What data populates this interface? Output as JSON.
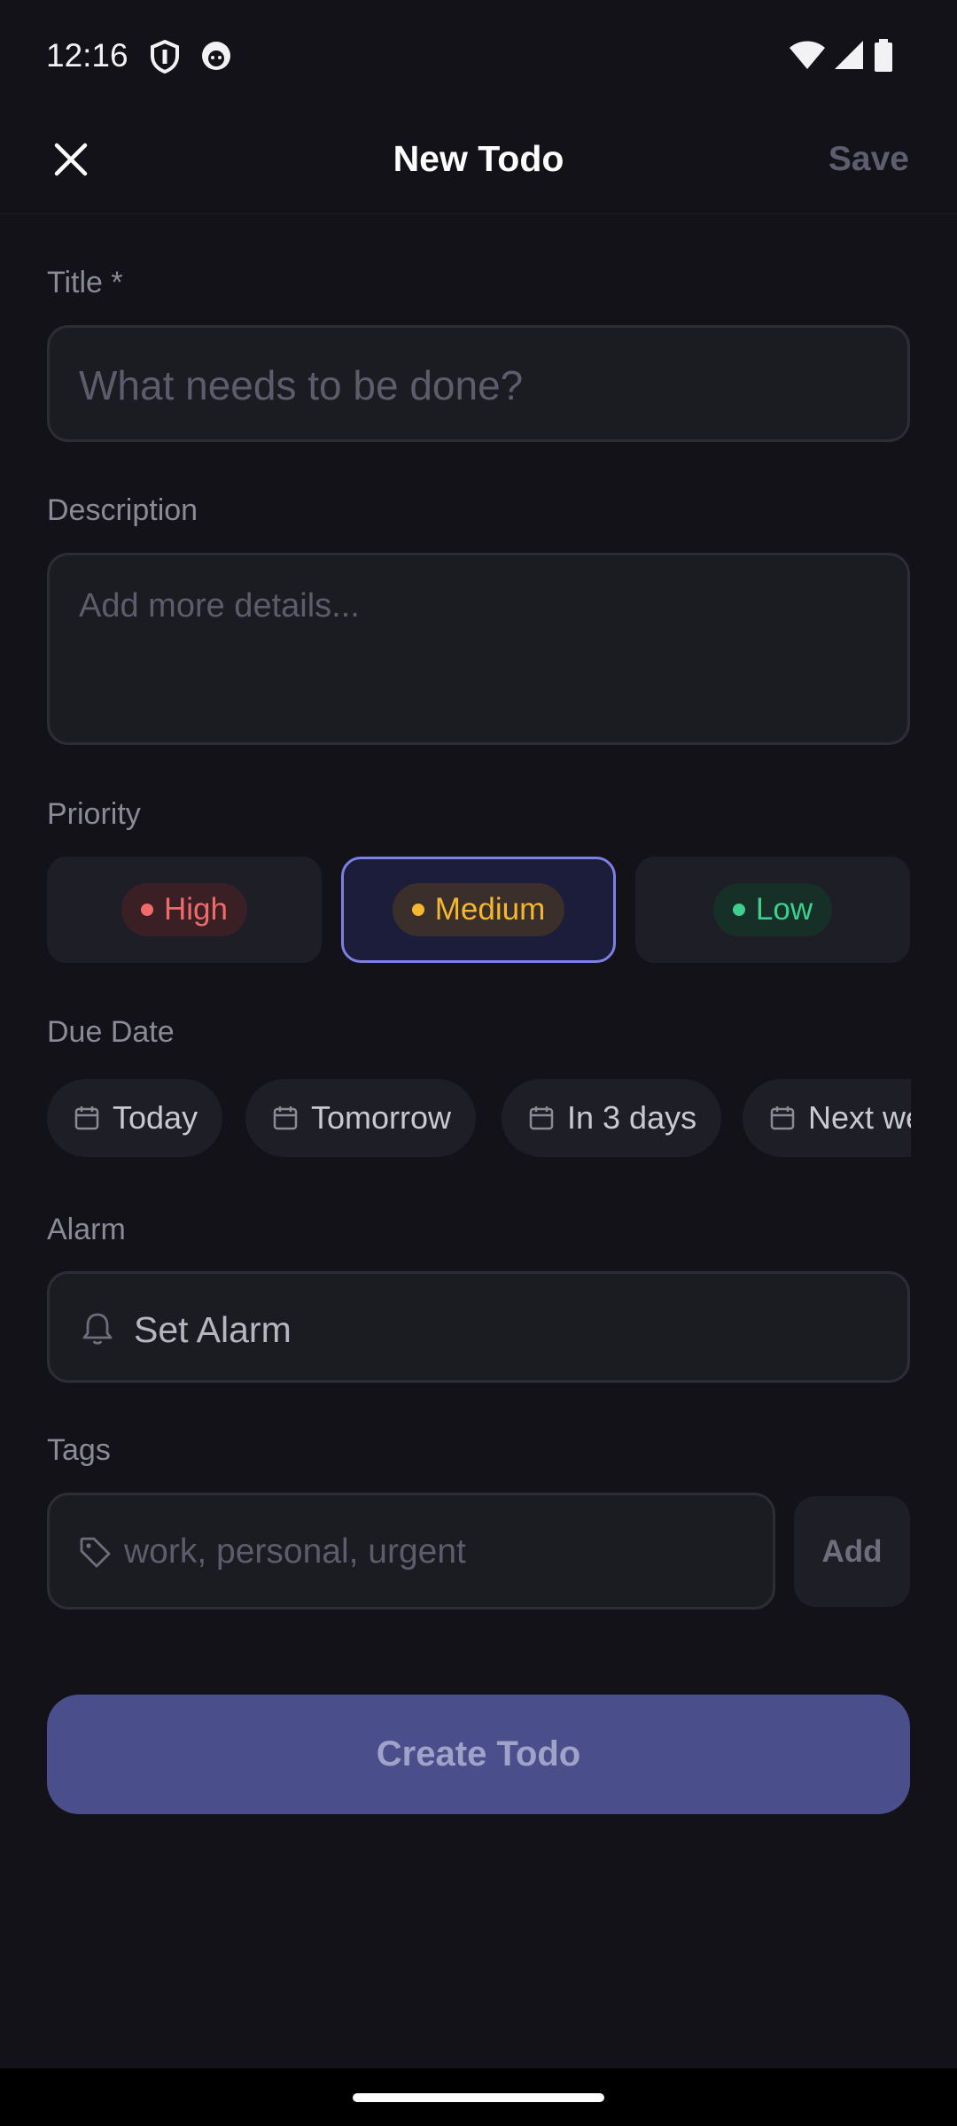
{
  "status_bar": {
    "time": "12:16"
  },
  "top_bar": {
    "title": "New Todo",
    "save_label": "Save"
  },
  "form": {
    "title_label": "Title *",
    "title_placeholder": "What needs to be done?",
    "description_label": "Description",
    "description_placeholder": "Add more details...",
    "priority_label": "Priority",
    "priorities": [
      {
        "label": "High",
        "color": "#f06a6a",
        "selected": false
      },
      {
        "label": "Medium",
        "color": "#f5b730",
        "selected": true
      },
      {
        "label": "Low",
        "color": "#3ccf8e",
        "selected": false
      }
    ],
    "due_date_label": "Due Date",
    "due_dates": [
      "Today",
      "Tomorrow",
      "In 3 days",
      "Next week"
    ],
    "alarm_label": "Alarm",
    "alarm_button": "Set Alarm",
    "tags_label": "Tags",
    "tags_placeholder": "work, personal, urgent",
    "tags_add": "Add",
    "submit": "Create Todo"
  },
  "icons": {
    "close": "close-icon",
    "calendar": "calendar-icon",
    "bell": "bell-icon",
    "tag": "tag-icon"
  },
  "colors": {
    "background": "#121218",
    "accent": "#7b7fe6",
    "button": "#4a4e8a"
  }
}
